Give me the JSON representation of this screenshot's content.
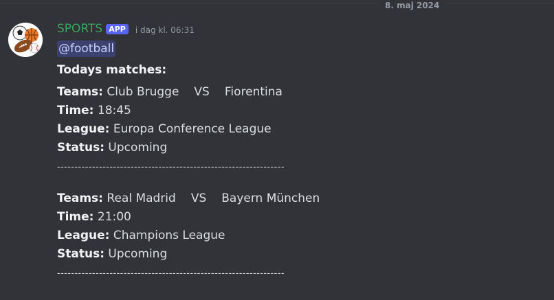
{
  "date_divider": "8. maj 2024",
  "message": {
    "author": "SPORTS",
    "badge": "APP",
    "timestamp": "i dag kl. 06:31",
    "mention": "@football",
    "intro": "Todays matches:"
  },
  "labels": {
    "teams": "Teams:",
    "time": "Time:",
    "league": "League:",
    "status": "Status:"
  },
  "matches": [
    {
      "home": "Club Brugge",
      "vs": "VS",
      "away": "Fiorentina",
      "time": "18:45",
      "league": "Europa Conference League",
      "status": "Upcoming"
    },
    {
      "home": "Real Madrid",
      "vs": "VS",
      "away": "Bayern München",
      "time": "21:00",
      "league": "Champions League",
      "status": "Upcoming"
    }
  ],
  "separator": "-----------------------------------------------------------------",
  "colors": {
    "background": "#313338",
    "username": "#3ba55d",
    "app_badge": "#5865f2",
    "mention_bg": "#3c4270",
    "text": "#dbdee1"
  },
  "icons": {
    "avatar": "sports-balls-icon"
  }
}
